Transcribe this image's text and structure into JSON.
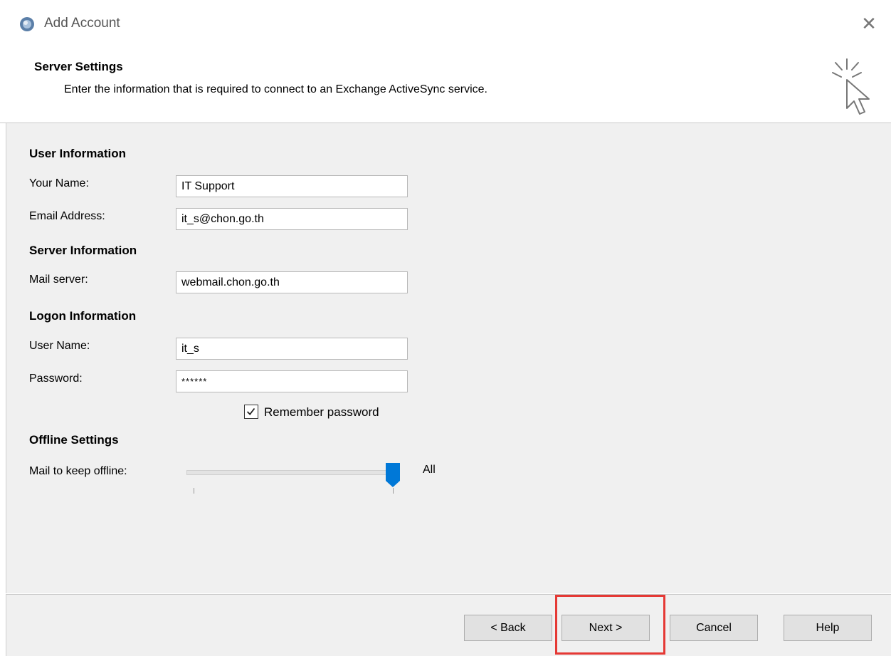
{
  "window": {
    "title": "Add Account",
    "close_icon": "close-icon"
  },
  "header": {
    "title": "Server Settings",
    "subtitle": "Enter the information that is required to connect to an Exchange ActiveSync service."
  },
  "user_info": {
    "heading": "User Information",
    "name_label": "Your Name:",
    "name_value": "IT Support",
    "email_label": "Email Address:",
    "email_value": "it_s@chon.go.th"
  },
  "server_info": {
    "heading": "Server Information",
    "mail_server_label": "Mail server:",
    "mail_server_value": "webmail.chon.go.th"
  },
  "logon_info": {
    "heading": "Logon Information",
    "username_label": "User Name:",
    "username_value": "it_s",
    "password_label": "Password:",
    "password_value": "******",
    "remember_label": "Remember password",
    "remember_checked": true
  },
  "offline": {
    "heading": "Offline Settings",
    "mail_keep_label": "Mail to keep offline:",
    "slider_value_label": "All",
    "slider_level": 1.0
  },
  "buttons": {
    "back": "< Back",
    "next": "Next >",
    "cancel": "Cancel",
    "help": "Help"
  },
  "colors": {
    "accent": "#0078d7",
    "highlight": "#e53935"
  }
}
